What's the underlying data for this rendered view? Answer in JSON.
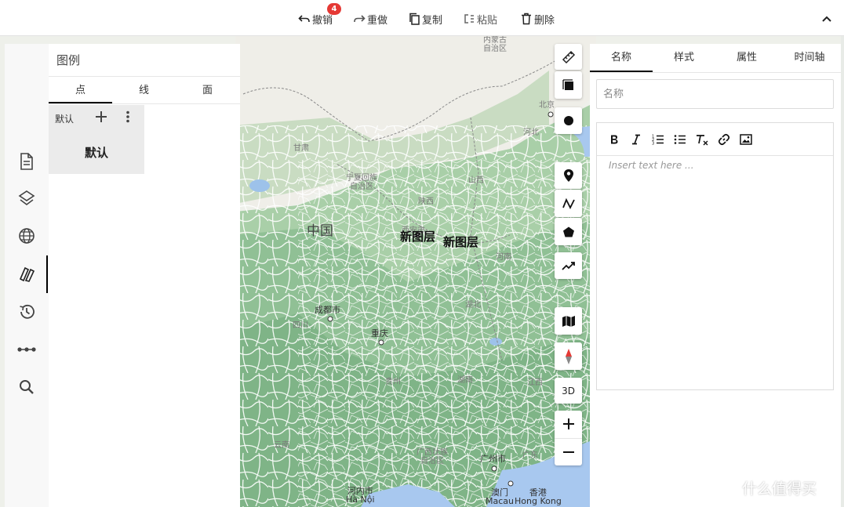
{
  "toolbar": {
    "undo_label": "撤销",
    "undo_badge": "4",
    "redo_label": "重做",
    "copy_label": "复制",
    "paste_label": "粘贴",
    "delete_label": "删除"
  },
  "rail": {
    "icons": [
      "document-icon",
      "layers-icon",
      "globe-icon",
      "legend-icon",
      "history-icon",
      "route-icon",
      "search-icon"
    ],
    "active_index": 3
  },
  "legend": {
    "title": "图例",
    "tabs": [
      "点",
      "线",
      "面"
    ],
    "active_tab": 0,
    "card": {
      "header": "默认",
      "name": "默认"
    }
  },
  "map_tools": {
    "icons": [
      "ruler-icon",
      "square-draw-icon",
      "circle-draw-icon",
      "marker-icon",
      "polyline-icon",
      "polygon-icon",
      "trend-icon",
      "map-icon",
      "compass-icon",
      "zoom-in-icon",
      "zoom-out-icon"
    ],
    "view_3d_label": "3D"
  },
  "map": {
    "labels": {
      "inner_mongolia": "内蒙古\n自治区",
      "beijing": "北京",
      "hebei": "河北",
      "gansu": "甘肃",
      "ningxia": "宁夏回族\n自治区",
      "shanxi": "山西",
      "shaanxi": "陕西",
      "china": "中国",
      "xian": "西安市",
      "henan": "河南",
      "chengdu": "成都市",
      "sichuan": "四川",
      "hubei": "湖北",
      "chongqing": "重庆",
      "guizhou": "贵州",
      "hunan": "湖南",
      "jiangxi": "江西",
      "yunnan": "云南",
      "guangxi": "广西壮族\n自治区",
      "guangzhou": "广州市",
      "guangdong": "广东",
      "hanoi": "河内市\nHà Nội",
      "macau": "澳门\nMacau",
      "hongkong": "香港\nHong Kong"
    },
    "layer_labels": [
      "新图层",
      "新图层"
    ]
  },
  "props": {
    "tabs": [
      "名称",
      "样式",
      "属性",
      "时间轴"
    ],
    "active_tab": 0,
    "name_placeholder": "名称",
    "editor_placeholder": "Insert text here ...",
    "editor_tools": [
      "bold-icon",
      "italic-icon",
      "ordered-list-icon",
      "bullet-list-icon",
      "clear-format-icon",
      "link-icon",
      "image-icon"
    ]
  },
  "watermark": {
    "text": "什么值得买"
  }
}
